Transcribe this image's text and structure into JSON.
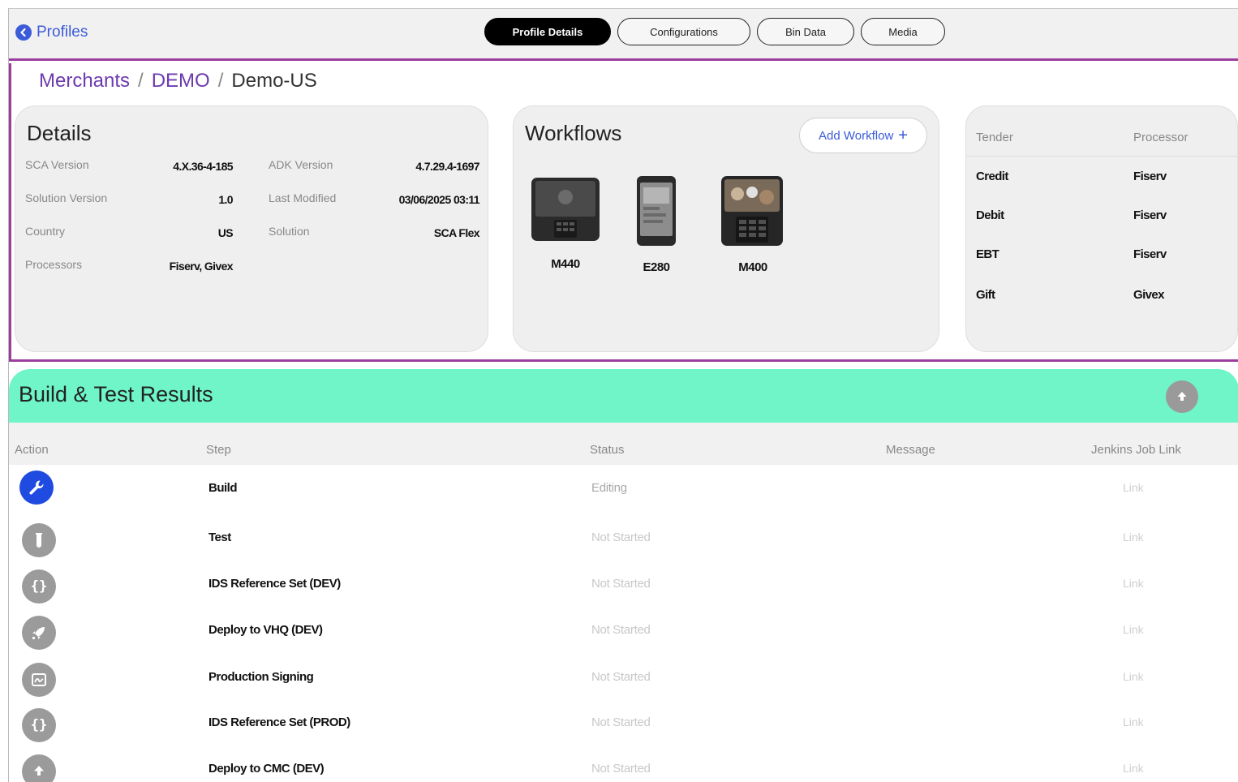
{
  "nav": {
    "back_label": "Profiles",
    "tabs": [
      {
        "label": "Profile Details",
        "active": true
      },
      {
        "label": "Configurations",
        "active": false
      },
      {
        "label": "Bin Data",
        "active": false
      },
      {
        "label": "Media",
        "active": false
      }
    ]
  },
  "breadcrumb": [
    "Merchants",
    "DEMO",
    "Demo-US"
  ],
  "details": {
    "title": "Details",
    "fields": {
      "sca_version": {
        "label": "SCA Version",
        "value": "4.X.36-4-185"
      },
      "adk_version": {
        "label": "ADK Version",
        "value": "4.7.29.4-1697"
      },
      "solution_version": {
        "label": "Solution Version",
        "value": "1.0"
      },
      "last_modified": {
        "label": "Last Modified",
        "value": "03/06/2025 03:11"
      },
      "country": {
        "label": "Country",
        "value": "US"
      },
      "solution": {
        "label": "Solution",
        "value": "SCA Flex"
      },
      "processors": {
        "label": "Processors",
        "value": "Fiserv, Givex"
      }
    }
  },
  "workflows": {
    "title": "Workflows",
    "add_label": "Add Workflow",
    "devices": [
      "M440",
      "E280",
      "M400"
    ]
  },
  "tender_table": {
    "headers": [
      "Tender",
      "Processor"
    ],
    "rows": [
      [
        "Credit",
        "Fiserv"
      ],
      [
        "Debit",
        "Fiserv"
      ],
      [
        "EBT",
        "Fiserv"
      ],
      [
        "Gift",
        "Givex"
      ]
    ]
  },
  "build": {
    "title": "Build & Test Results",
    "headers": [
      "Action",
      "Step",
      "Status",
      "Message",
      "Jenkins Job Link"
    ],
    "rows": [
      {
        "icon": "wrench-icon",
        "step": "Build",
        "status": "Editing",
        "link": "Link"
      },
      {
        "icon": "test-tube-icon",
        "step": "Test",
        "status": "Not Started",
        "link": "Link"
      },
      {
        "icon": "braces-icon",
        "step": "IDS Reference Set (DEV)",
        "status": "Not Started",
        "link": "Link"
      },
      {
        "icon": "rocket-icon",
        "step": "Deploy to VHQ (DEV)",
        "status": "Not Started",
        "link": "Link"
      },
      {
        "icon": "signature-icon",
        "step": "Production Signing",
        "status": "Not Started",
        "link": "Link"
      },
      {
        "icon": "braces-icon",
        "step": "IDS Reference Set (PROD)",
        "status": "Not Started",
        "link": "Link"
      },
      {
        "icon": "upload-icon",
        "step": "Deploy to CMC (DEV)",
        "status": "Not Started",
        "link": "Link"
      }
    ]
  },
  "colors": {
    "accent": "#9a3f9e",
    "link": "#3b5bd9",
    "build_bar": "#6ff5c8",
    "active_action": "#1f4be0"
  }
}
